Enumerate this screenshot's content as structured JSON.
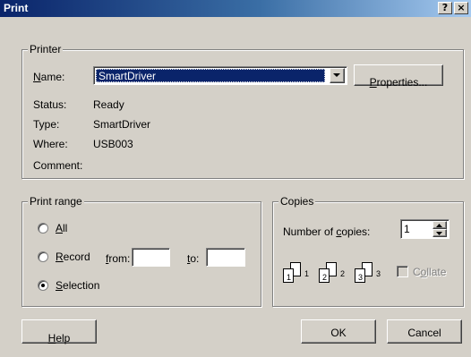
{
  "window": {
    "title": "Print",
    "help_glyph": "?",
    "close_glyph": "×"
  },
  "printer": {
    "group_label": "Printer",
    "name_label": "Name:",
    "name_value": "SmartDriver",
    "properties_label": "Properties...",
    "status_label": "Status:",
    "status_value": "Ready",
    "type_label": "Type:",
    "type_value": "SmartDriver",
    "where_label": "Where:",
    "where_value": "USB003",
    "comment_label": "Comment:",
    "comment_value": ""
  },
  "print_range": {
    "group_label": "Print range",
    "all_label": "All",
    "record_label": "Record",
    "from_label": "from:",
    "from_value": "",
    "to_label": "to:",
    "to_value": "",
    "selection_label": "Selection",
    "selected": "selection"
  },
  "copies": {
    "group_label": "Copies",
    "number_label": "Number of copies:",
    "number_value": "1",
    "collate_label": "Collate",
    "collate_checked": false,
    "page_numbers": [
      "1",
      "1",
      "2",
      "2",
      "3",
      "3"
    ]
  },
  "footer": {
    "help_label": "Help",
    "ok_label": "OK",
    "cancel_label": "Cancel"
  },
  "colors": {
    "title_bar": "#0a246a",
    "dialog_face": "#d4d0c8",
    "selection": "#0a246a"
  }
}
